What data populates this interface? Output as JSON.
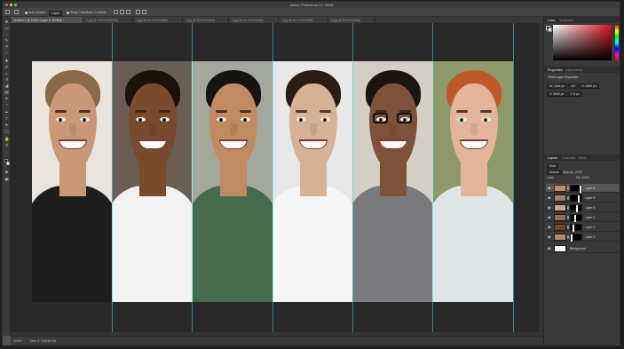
{
  "app": {
    "title": "Adobe Photoshop CC 2018"
  },
  "options_bar": {
    "auto_select_label": "Auto-Select:",
    "auto_select_target": "Layer",
    "show_transform_label": "Show Transform Controls"
  },
  "tabs": [
    {
      "label": "Untitled-1 @ 100% (Layer 6, RGB/8) *",
      "active": true
    },
    {
      "label": "1.jpg @ 33.3% (RGB/8)",
      "active": false
    },
    {
      "label": "2.jpg @ 66.7% (RGB/8)",
      "active": false
    },
    {
      "label": "3.jpg @ 50% (RGB/8)",
      "active": false
    },
    {
      "label": "4.jpg @ 66.7% (RGB/8)",
      "active": false
    },
    {
      "label": "5.jpg @ 66.7% (RGB/8)",
      "active": false
    },
    {
      "label": "6.jpg @ 50% (RGB/8)",
      "active": false
    }
  ],
  "panels": {
    "color_tabs": [
      "Color",
      "Swatches"
    ],
    "properties_tabs": [
      "Properties",
      "Adjustments"
    ],
    "properties_title": "Pixel Layer Properties",
    "properties_fields": {
      "w": "W: 1044 px",
      "h": "H: 1500 px",
      "x": "X: 5000 px",
      "y": "Y: 0 px",
      "link": "GO"
    },
    "layers_tabs": [
      "Layers",
      "Channels",
      "Paths"
    ],
    "kind_filter": "Kind",
    "blend_mode": "Normal",
    "opacity": "Opacity: 100%",
    "lock_label": "Lock:",
    "fill": "Fill: 100%",
    "layers": [
      {
        "name": "Layer 6",
        "active": true,
        "thumb": "#c98a5e",
        "mask_x": 0.83
      },
      {
        "name": "Layer 5",
        "active": false,
        "thumb": "#a5806a",
        "mask_x": 0.66
      },
      {
        "name": "Layer 4",
        "active": false,
        "thumb": "#c9a38a",
        "mask_x": 0.5
      },
      {
        "name": "Layer 3",
        "active": false,
        "thumb": "#8f6a4c",
        "mask_x": 0.33
      },
      {
        "name": "Layer 2",
        "active": false,
        "thumb": "#6b4a33",
        "mask_x": 0.16
      },
      {
        "name": "Layer 1",
        "active": false,
        "thumb": "#b58a6a",
        "mask_x": 0.0
      }
    ],
    "background_layer": "Background"
  },
  "status": {
    "zoom": "100%",
    "doc": "Doc: 5.72M/38.3M"
  },
  "canvas_photos": [
    {
      "name": "portrait-1",
      "bg": "#e9e4dc",
      "hair": "#8b6a4a",
      "skin": "#c99877",
      "shirt": "#1d1d1d",
      "glasses": false
    },
    {
      "name": "portrait-2",
      "bg": "#6a5e52",
      "hair": "#1b120c",
      "skin": "#7a4a2c",
      "shirt": "#f2f2f2",
      "glasses": false
    },
    {
      "name": "portrait-3",
      "bg": "#a4a79c",
      "hair": "#161412",
      "skin": "#c08b63",
      "shirt": "#456a4c",
      "glasses": false
    },
    {
      "name": "portrait-4",
      "bg": "#e8e8e8",
      "hair": "#2a1b14",
      "skin": "#d8b295",
      "shirt": "#f6f6f6",
      "glasses": false
    },
    {
      "name": "portrait-5",
      "bg": "#d3cfc4",
      "hair": "#1c1410",
      "skin": "#7e5238",
      "shirt": "#7a7a7e",
      "glasses": true
    },
    {
      "name": "portrait-6",
      "bg": "#8e9a6a",
      "hair": "#c0592a",
      "skin": "#e3b59a",
      "shirt": "#dfe6e8",
      "glasses": false
    }
  ]
}
